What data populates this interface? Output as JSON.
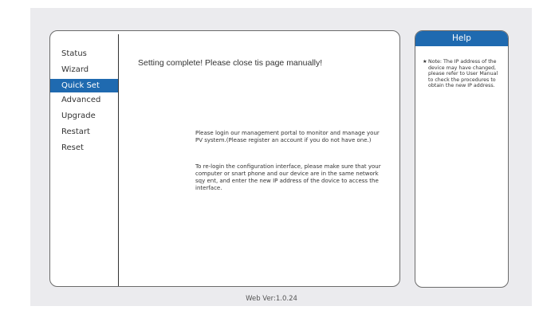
{
  "sidebar": {
    "items": [
      {
        "label": "Status"
      },
      {
        "label": "Wizard"
      },
      {
        "label": "Quick Set"
      },
      {
        "label": "Advanced"
      },
      {
        "label": "Upgrade"
      },
      {
        "label": "Restart"
      },
      {
        "label": "Reset"
      }
    ],
    "active_index": 2
  },
  "main": {
    "complete_message": "Setting complete! Please close tis page manually!",
    "info_paragraph_1": "Please login our management portal to monitor and manage your PV system.(Please register an account if you do not have one.)",
    "info_paragraph_2": "To re-login the configuration interface, please make sure that your computer or snart phone and our device are in the same network sqy ent, and enter the new IP address of the dovice to access the interface."
  },
  "help": {
    "title": "Help",
    "star": "★",
    "note": "Note: The IP address of the device may have changed, please refer to User Manual to check the procedures to obtain the new IP address."
  },
  "footer": {
    "version": "Web Ver:1.0.24"
  },
  "colors": {
    "accent": "#1f6ab0",
    "background": "#ebebee"
  }
}
